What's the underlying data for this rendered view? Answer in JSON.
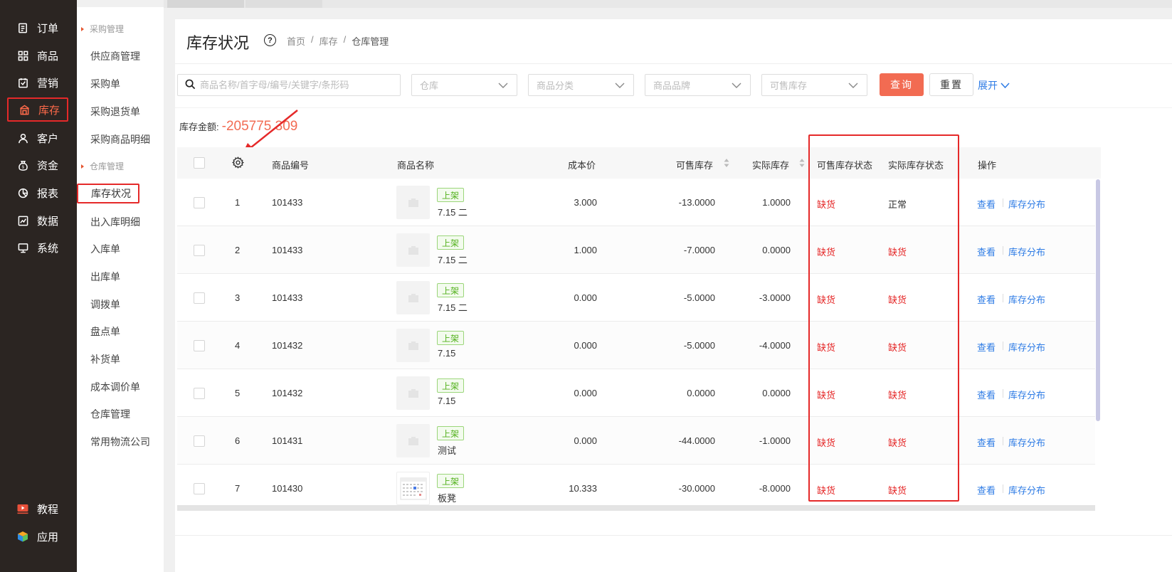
{
  "nav": {
    "items": [
      {
        "label": "订单",
        "icon": "order-icon"
      },
      {
        "label": "商品",
        "icon": "grid-icon"
      },
      {
        "label": "营销",
        "icon": "marketing-icon"
      },
      {
        "label": "库存",
        "icon": "warehouse-icon",
        "active": true
      },
      {
        "label": "客户",
        "icon": "user-icon"
      },
      {
        "label": "资金",
        "icon": "money-bag-icon"
      },
      {
        "label": "报表",
        "icon": "pie-chart-icon"
      },
      {
        "label": "数据",
        "icon": "data-icon"
      },
      {
        "label": "系统",
        "icon": "monitor-icon"
      }
    ],
    "bottom": [
      {
        "label": "教程",
        "icon": "video-icon"
      },
      {
        "label": "应用",
        "icon": "cube-icon"
      }
    ]
  },
  "subnav": {
    "group1": "采购管理",
    "group1_items": [
      "供应商管理",
      "采购单",
      "采购退货单",
      "采购商品明细"
    ],
    "group2": "仓库管理",
    "group2_items": [
      "库存状况",
      "出入库明细",
      "入库单",
      "出库单",
      "调拨单",
      "盘点单",
      "补货单",
      "成本调价单",
      "仓库管理",
      "常用物流公司"
    ]
  },
  "page": {
    "title": "库存状况",
    "help": "?",
    "breadcrumb": [
      "首页",
      "/",
      "库存",
      "/",
      "仓库管理"
    ]
  },
  "filters": {
    "search_placeholder": "商品名称/首字母/编号/关键字/条形码",
    "warehouse": "仓库",
    "category": "商品分类",
    "brand": "商品品牌",
    "available": "可售库存",
    "query": "查询",
    "reset": "重置",
    "expand": "展开"
  },
  "summary": {
    "label": "库存金额:",
    "value": "-205775.309"
  },
  "table": {
    "headers": {
      "code": "商品编号",
      "name": "商品名称",
      "cost": "成本价",
      "available": "可售库存",
      "actual": "实际库存",
      "available_status": "可售库存状态",
      "actual_status": "实际库存状态",
      "ops": "操作"
    },
    "rows": [
      {
        "idx": "1",
        "code": "101433",
        "tag": "上架",
        "name": "7.15 二",
        "cost": "3.000",
        "available": "-13.0000",
        "actual": "1.0000",
        "avail_status": "缺货",
        "actual_status": "正常",
        "view": "查看",
        "dist": "库存分布"
      },
      {
        "idx": "2",
        "code": "101433",
        "tag": "上架",
        "name": "7.15 二",
        "cost": "1.000",
        "available": "-7.0000",
        "actual": "0.0000",
        "avail_status": "缺货",
        "actual_status": "缺货",
        "view": "查看",
        "dist": "库存分布"
      },
      {
        "idx": "3",
        "code": "101433",
        "tag": "上架",
        "name": "7.15 二",
        "cost": "0.000",
        "available": "-5.0000",
        "actual": "-3.0000",
        "avail_status": "缺货",
        "actual_status": "缺货",
        "view": "查看",
        "dist": "库存分布"
      },
      {
        "idx": "4",
        "code": "101432",
        "tag": "上架",
        "name": "7.15",
        "cost": "0.000",
        "available": "-5.0000",
        "actual": "-4.0000",
        "avail_status": "缺货",
        "actual_status": "缺货",
        "view": "查看",
        "dist": "库存分布"
      },
      {
        "idx": "5",
        "code": "101432",
        "tag": "上架",
        "name": "7.15",
        "cost": "0.000",
        "available": "0.0000",
        "actual": "0.0000",
        "avail_status": "缺货",
        "actual_status": "缺货",
        "view": "查看",
        "dist": "库存分布"
      },
      {
        "idx": "6",
        "code": "101431",
        "tag": "上架",
        "name": "测试",
        "cost": "0.000",
        "available": "-44.0000",
        "actual": "-1.0000",
        "avail_status": "缺货",
        "actual_status": "缺货",
        "view": "查看",
        "dist": "库存分布"
      },
      {
        "idx": "7",
        "code": "101430",
        "tag": "上架",
        "name": "板凳",
        "cost": "10.333",
        "available": "-30.0000",
        "actual": "-8.0000",
        "avail_status": "缺货",
        "actual_status": "缺货",
        "view": "查看",
        "dist": "库存分布"
      }
    ]
  },
  "colors": {
    "accent": "#f26b52",
    "nav_bg": "#2b2522",
    "highlight_red": "#e52929",
    "link": "#2d7be5",
    "tag_green": "#52b11c"
  }
}
